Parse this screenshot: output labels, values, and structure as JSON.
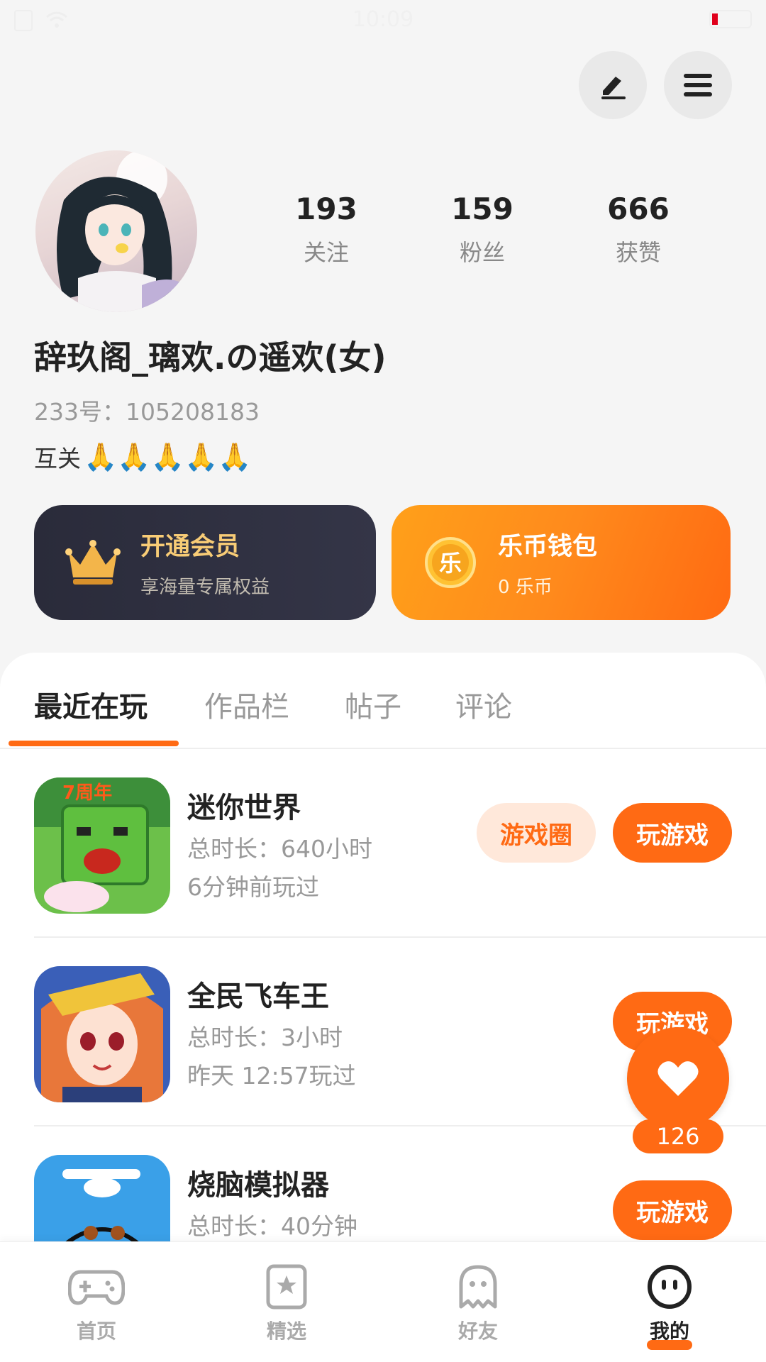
{
  "status_bar": {
    "time": "10:09"
  },
  "profile": {
    "nickname": "辞玖阁_璃欢.の遥欢(女)",
    "uid_text": "233号：105208183",
    "bio_text": "互关",
    "bio_emoji": "🙏🙏🙏🙏🙏",
    "stats": [
      {
        "value": "193",
        "label": "关注"
      },
      {
        "value": "159",
        "label": "粉丝"
      },
      {
        "value": "666",
        "label": "获赞"
      }
    ]
  },
  "cards": {
    "vip": {
      "title": "开通会员",
      "subtitle": "享海量专属权益"
    },
    "wallet": {
      "icon_char": "乐",
      "title": "乐币钱包",
      "subtitle": "0 乐币"
    }
  },
  "tabs": [
    {
      "label": "最近在玩"
    },
    {
      "label": "作品栏"
    },
    {
      "label": "帖子"
    },
    {
      "label": "评论"
    }
  ],
  "games": [
    {
      "name": "迷你世界",
      "duration": "总时长：640小时",
      "last_played": "6分钟前玩过",
      "circle_label": "游戏圈",
      "play_label": "玩游戏"
    },
    {
      "name": "全民飞车王",
      "duration": "总时长：3小时",
      "last_played": "昨天 12:57玩过",
      "play_label": "玩游戏"
    },
    {
      "name": "烧脑模拟器",
      "duration": "总时长：40分钟",
      "play_label": "玩游戏"
    }
  ],
  "like_float": {
    "count": "126"
  },
  "bottom_nav": [
    {
      "label": "首页",
      "icon": "gamepad-icon"
    },
    {
      "label": "精选",
      "icon": "star-bookmark-icon"
    },
    {
      "label": "好友",
      "icon": "ghost-icon"
    },
    {
      "label": "我的",
      "icon": "smiley-face-icon"
    }
  ],
  "colors": {
    "accent": "#ff6a14",
    "vip_dark": "#2a2b3a",
    "vip_gold": "#f8cc76",
    "wallet_orange": "#ff8a1c"
  }
}
